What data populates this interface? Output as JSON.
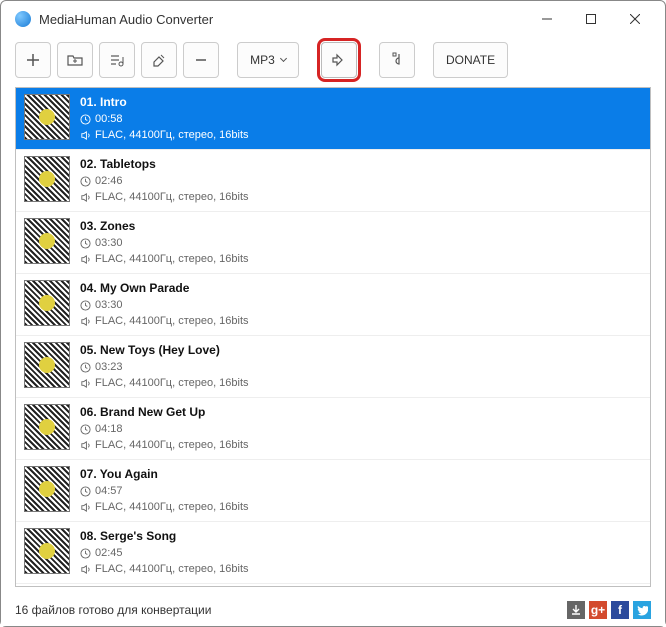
{
  "app": {
    "title": "MediaHuman Audio Converter"
  },
  "toolbar": {
    "format_label": "MP3",
    "donate_label": "DONATE"
  },
  "tracks": [
    {
      "title": "01. Intro",
      "duration": "00:58",
      "format": "FLAC, 44100Гц, стерео, 16bits",
      "selected": true
    },
    {
      "title": "02. Tabletops",
      "duration": "02:46",
      "format": "FLAC, 44100Гц, стерео, 16bits",
      "selected": false
    },
    {
      "title": "03. Zones",
      "duration": "03:30",
      "format": "FLAC, 44100Гц, стерео, 16bits",
      "selected": false
    },
    {
      "title": "04. My Own Parade",
      "duration": "03:30",
      "format": "FLAC, 44100Гц, стерео, 16bits",
      "selected": false
    },
    {
      "title": "05. New Toys (Hey Love)",
      "duration": "03:23",
      "format": "FLAC, 44100Гц, стерео, 16bits",
      "selected": false
    },
    {
      "title": "06. Brand New Get Up",
      "duration": "04:18",
      "format": "FLAC, 44100Гц, стерео, 16bits",
      "selected": false
    },
    {
      "title": "07. You Again",
      "duration": "04:57",
      "format": "FLAC, 44100Гц, стерео, 16bits",
      "selected": false
    },
    {
      "title": "08. Serge's Song",
      "duration": "02:45",
      "format": "FLAC, 44100Гц, стерео, 16bits",
      "selected": false
    }
  ],
  "status": {
    "text": "16 файлов готово для конвертации"
  }
}
